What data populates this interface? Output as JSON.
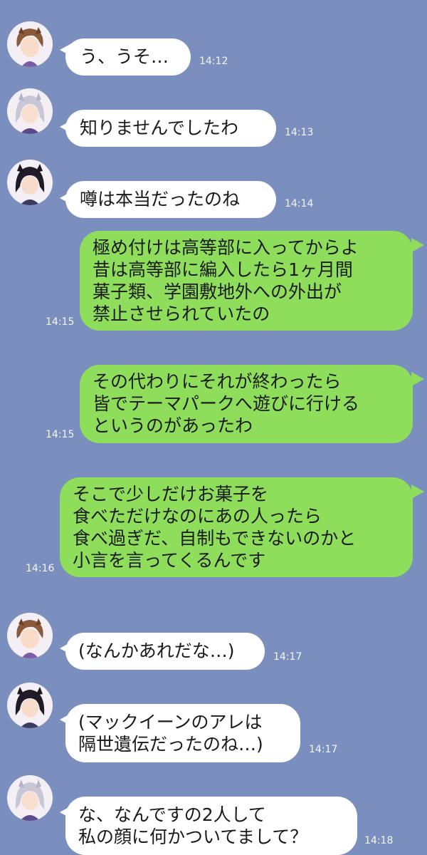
{
  "colors": {
    "background": "#7a8fbd",
    "incoming_bubble": "#ffffff",
    "outgoing_bubble": "#8fde5b",
    "timestamp": "#f4f6fb"
  },
  "messages": [
    {
      "direction": "incoming",
      "avatar": "brown-hair-character-avatar-icon",
      "text": "う、うそ…",
      "time": "14:12"
    },
    {
      "direction": "incoming",
      "avatar": "silver-hair-character-avatar-icon",
      "text": "知りませんでしたわ",
      "time": "14:13"
    },
    {
      "direction": "incoming",
      "avatar": "black-hair-character-avatar-icon",
      "text": "噂は本当だったのね",
      "time": "14:14"
    },
    {
      "direction": "outgoing",
      "text": "極め付けは高等部に入ってからよ\n昔は高等部に編入したら1ヶ月間\n菓子類、学園敷地外への外出が\n禁止させられていたの",
      "time": "14:15"
    },
    {
      "direction": "outgoing",
      "text": "その代わりにそれが終わったら\n皆でテーマパークへ遊びに行ける\nというのがあったわ",
      "time": "14:15"
    },
    {
      "direction": "outgoing",
      "text": "そこで少しだけお菓子を\n食べただけなのにあの人ったら\n食べ過ぎだ、自制もできないのかと\n小言を言ってくるんです",
      "time": "14:16"
    },
    {
      "direction": "incoming",
      "avatar": "brown-hair-character-avatar-icon",
      "text": "(なんかあれだな…)",
      "time": "14:17"
    },
    {
      "direction": "incoming",
      "avatar": "black-hair-character-avatar-icon",
      "text": "(マックイーンのアレは\n隔世遺伝だったのね…)",
      "time": "14:17"
    },
    {
      "direction": "incoming",
      "avatar": "silver-hair-character-avatar-icon",
      "text": "な、なんですの2人して\n私の顔に何かついてまして？",
      "time": "14:18"
    }
  ]
}
